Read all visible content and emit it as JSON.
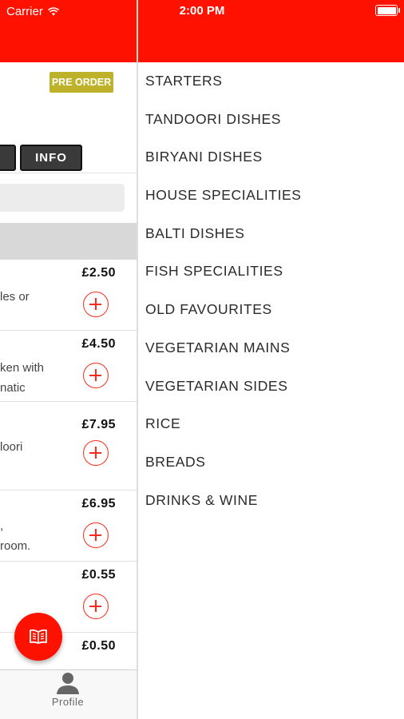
{
  "status_bar": {
    "carrier": "Carrier",
    "time": "2:00 PM"
  },
  "restaurant": {
    "preorder_badge": "PRE ORDER"
  },
  "segment": {
    "left_label": "",
    "info_label": "INFO"
  },
  "items": [
    {
      "price": "£2.50",
      "desc": "les or"
    },
    {
      "price": "£4.50",
      "desc": "ken with\nnatic"
    },
    {
      "price": "£7.95",
      "desc": "loori"
    },
    {
      "price": "£6.95",
      "desc": ",\nroom."
    },
    {
      "price": "£0.55",
      "desc": ""
    },
    {
      "price": "£0.50",
      "desc": ""
    }
  ],
  "tabbar": {
    "profile_label": "Profile"
  },
  "menu": {
    "categories": [
      "STARTERS",
      "TANDOORI DISHES",
      "BIRYANI DISHES",
      "HOUSE SPECIALITIES",
      "BALTI DISHES",
      "FISH SPECIALITIES",
      "OLD FAVOURITES",
      "VEGETARIAN MAINS",
      "VEGETARIAN SIDES",
      "RICE",
      "BREADS",
      "DRINKS & WINE"
    ]
  },
  "colors": {
    "accent": "#ff1100",
    "preorder": "#bdb22a",
    "segment_bg": "#3a3a3a"
  },
  "icons": {
    "wifi": "wifi-icon",
    "battery": "battery-icon",
    "add": "plus-circle-icon",
    "menu_book": "book-icon",
    "profile": "person-icon"
  }
}
